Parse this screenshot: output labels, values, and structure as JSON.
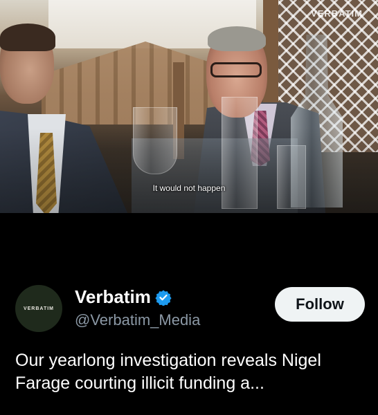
{
  "video": {
    "subtitle": "It would not happen",
    "watermark": "VERBATIM"
  },
  "account": {
    "avatar_text": "VERBATIM",
    "display_name": "Verbatim",
    "handle": "@Verbatim_Media",
    "verified_icon": "verified-badge-icon",
    "follow_label": "Follow",
    "colors": {
      "verified": "#1d9bf0",
      "handle": "#8b98a5",
      "follow_bg": "#eff3f4"
    }
  },
  "tweet": {
    "text": "Our yearlong investigation reveals Nigel Farage courting illicit funding a..."
  }
}
